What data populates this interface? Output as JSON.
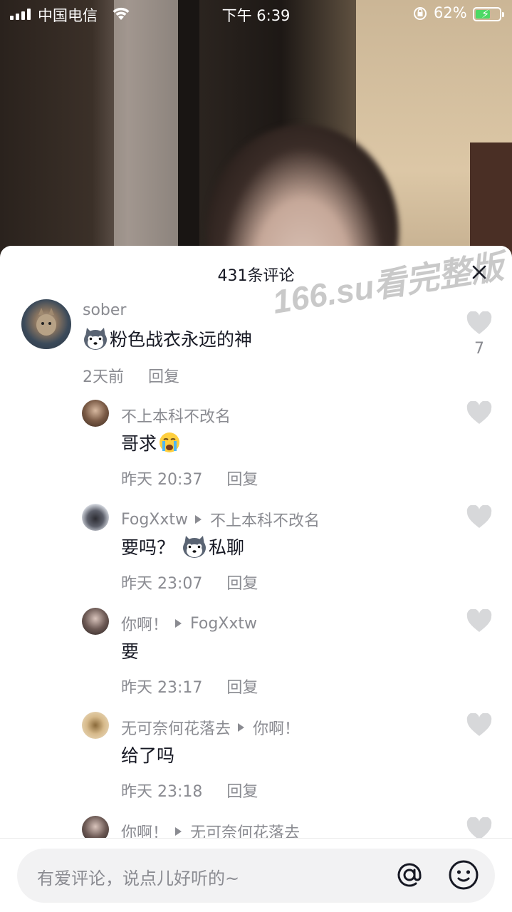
{
  "status_bar": {
    "carrier": "中国电信",
    "time": "下午 6:39",
    "battery_percent": "62%",
    "battery_level": 0.62
  },
  "sheet": {
    "title": "431条评论",
    "watermark": "166.su看完整版"
  },
  "comments": [
    {
      "username": "sober",
      "reply_to": "",
      "text": "粉色战衣永远的神",
      "emoji": "husky-emoji",
      "time": "2天前",
      "reply_label": "回复",
      "likes": "7"
    },
    {
      "username": "不上本科不改名",
      "reply_to": "",
      "text": "哥求",
      "emoji": "crying-emoji",
      "time": "昨天 20:37",
      "reply_label": "回复"
    },
    {
      "username": "FogXxtw",
      "reply_to": "不上本科不改名",
      "text_before": "要吗？",
      "text_after": "私聊",
      "emoji": "husky-emoji",
      "time": "昨天 23:07",
      "reply_label": "回复"
    },
    {
      "username": "你啊！",
      "reply_to": "FogXxtw",
      "text": "要",
      "time": "昨天 23:17",
      "reply_label": "回复"
    },
    {
      "username": "无可奈何花落去",
      "reply_to": "你啊！",
      "text": "给了吗",
      "time": "昨天 23:18",
      "reply_label": "回复"
    },
    {
      "username": "你啊！",
      "reply_to": "无可奈何花落去"
    }
  ],
  "input": {
    "placeholder": "有爱评论，说点儿好听的~"
  },
  "icons": {
    "at": "at-icon",
    "emoji": "smiley-icon",
    "like": "heart-icon",
    "close": "close-icon"
  }
}
